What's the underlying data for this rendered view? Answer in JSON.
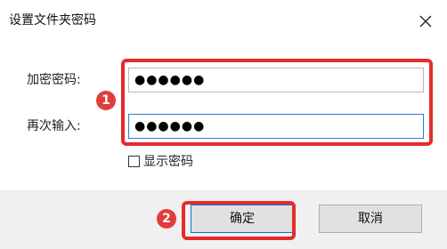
{
  "dialog": {
    "title": "设置文件夹密码",
    "close_icon": "close-icon"
  },
  "form": {
    "password_label": "加密密码:",
    "password_value": "●●●●●●",
    "confirm_label": "再次输入:",
    "confirm_value": "●●●●●●",
    "show_password_label": "显示密码",
    "show_password_checked": false
  },
  "annotations": {
    "badge_1": "1",
    "badge_2": "2",
    "highlight_color": "#e52b2b"
  },
  "buttons": {
    "ok_label": "确定",
    "cancel_label": "取消"
  }
}
